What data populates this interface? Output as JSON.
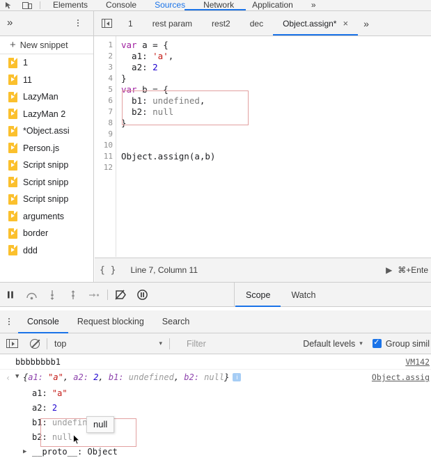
{
  "devtools": {
    "main_tabs": [
      "Elements",
      "Console",
      "Sources",
      "Network",
      "Application"
    ],
    "main_tabs_overflow": "»",
    "active_main_tab": "Sources",
    "inspect_icon": "inspect-element-icon",
    "device_icon": "device-toolbar-icon"
  },
  "navigator": {
    "more_tabs": "»",
    "menu_icon": "kebab-menu-icon",
    "new_snippet": "New snippet",
    "snippets": [
      "1",
      "11",
      "LazyMan",
      "LazyMan 2",
      "*Object.assi",
      "Person.js",
      "Script snipp",
      "Script snipp",
      "Script snipp",
      "arguments",
      "border",
      "ddd"
    ]
  },
  "editor_tabs": {
    "toggle_navigator_icon": "toggle-navigator-icon",
    "tabs": [
      {
        "label": "1",
        "active": false
      },
      {
        "label": "rest param",
        "active": false
      },
      {
        "label": "rest2",
        "active": false
      },
      {
        "label": "dec",
        "active": false
      },
      {
        "label": "Object.assign*",
        "active": true
      }
    ],
    "close_icon": "×",
    "overflow": "»"
  },
  "code": {
    "lines": [
      "1",
      "2",
      "3",
      "4",
      "5",
      "6",
      "7",
      "8",
      "9",
      "10",
      "11",
      "12"
    ],
    "text": [
      {
        "parts": [
          {
            "t": "var",
            "c": "kw"
          },
          {
            "t": " a = {",
            "c": ""
          }
        ]
      },
      {
        "parts": [
          {
            "t": "  a1: ",
            "c": ""
          },
          {
            "t": "'a'",
            "c": "str"
          },
          {
            "t": ",",
            "c": ""
          }
        ]
      },
      {
        "parts": [
          {
            "t": "  a2: ",
            "c": ""
          },
          {
            "t": "2",
            "c": "num"
          }
        ]
      },
      {
        "parts": [
          {
            "t": "}",
            "c": ""
          }
        ]
      },
      {
        "parts": [
          {
            "t": "var",
            "c": "kw"
          },
          {
            "t": " b = {",
            "c": ""
          }
        ]
      },
      {
        "parts": [
          {
            "t": "  b1: ",
            "c": ""
          },
          {
            "t": "undefined",
            "c": "lit"
          },
          {
            "t": ",",
            "c": ""
          }
        ]
      },
      {
        "parts": [
          {
            "t": "  b2: ",
            "c": ""
          },
          {
            "t": "null",
            "c": "lit"
          }
        ]
      },
      {
        "parts": [
          {
            "t": "}",
            "c": ""
          }
        ]
      },
      {
        "parts": []
      },
      {
        "parts": []
      },
      {
        "parts": [
          {
            "t": "Object.assign(a,b)",
            "c": ""
          }
        ]
      },
      {
        "parts": []
      }
    ]
  },
  "editor_status": {
    "format_icon": "{ }",
    "position": "Line 7, Column 11",
    "run_icon": "▶",
    "run_shortcut": "⌘+Ente"
  },
  "debugger": {
    "buttons": [
      {
        "name": "resume-script-execution",
        "glyph": "pause"
      },
      {
        "name": "step-over-next-call",
        "glyph": "step-over"
      },
      {
        "name": "step-into-next-call",
        "glyph": "step-into"
      },
      {
        "name": "step-out-of-function",
        "glyph": "step-out"
      },
      {
        "name": "step",
        "glyph": "step"
      },
      {
        "name": "deactivate-breakpoints",
        "glyph": "deactivate"
      },
      {
        "name": "pause-on-exceptions",
        "glyph": "pause-exceptions"
      }
    ],
    "tabs": [
      {
        "label": "Scope",
        "active": true
      },
      {
        "label": "Watch",
        "active": false
      }
    ]
  },
  "drawer": {
    "menu_icon": "kebab-menu-icon",
    "tabs": [
      {
        "label": "Console",
        "active": true
      },
      {
        "label": "Request blocking",
        "active": false
      },
      {
        "label": "Search",
        "active": false
      }
    ]
  },
  "console_toolbar": {
    "sidebar_icon": "console-sidebar-icon",
    "clear_icon": "clear-console-icon",
    "context": "top",
    "context_caret": "▾",
    "filter_placeholder": "Filter",
    "levels": "Default levels",
    "levels_caret": "▾",
    "group_similar": "Group simil",
    "group_similar_checked": true
  },
  "console": {
    "messages": [
      {
        "type": "log",
        "text": "bbbbbbbb1",
        "source": "VM142"
      }
    ],
    "object": {
      "back_arrow": "‹",
      "disclosure": "▼",
      "preview": "{a1: \"a\", a2: 2, b1: undefined, b2: null}",
      "preview_parts": [
        {
          "t": "{",
          "c": "plain"
        },
        {
          "t": "a1: ",
          "c": "key"
        },
        {
          "t": "\"a\"",
          "c": "string"
        },
        {
          "t": ", ",
          "c": "plain"
        },
        {
          "t": "a2: ",
          "c": "key"
        },
        {
          "t": "2",
          "c": "number"
        },
        {
          "t": ", ",
          "c": "plain"
        },
        {
          "t": "b1: ",
          "c": "key"
        },
        {
          "t": "undefined",
          "c": "undef"
        },
        {
          "t": ", ",
          "c": "plain"
        },
        {
          "t": "b2: ",
          "c": "key"
        },
        {
          "t": "null",
          "c": "undef"
        },
        {
          "t": "}",
          "c": "plain"
        }
      ],
      "info_badge": "i",
      "source": "Object.assig",
      "properties": [
        {
          "key": "a1:",
          "value": "\"a\"",
          "kind": "string"
        },
        {
          "key": "a2:",
          "value": "2",
          "kind": "number"
        },
        {
          "key": "b1:",
          "value": "undefined",
          "kind": "undef"
        },
        {
          "key": "b2:",
          "value": "null",
          "kind": "undef"
        }
      ],
      "proto": {
        "arrow": "▶",
        "key": "__proto__:",
        "value": "Object"
      }
    }
  },
  "annotations": {
    "tooltip_text": "null",
    "highlight_color": "#e2a0a0"
  }
}
